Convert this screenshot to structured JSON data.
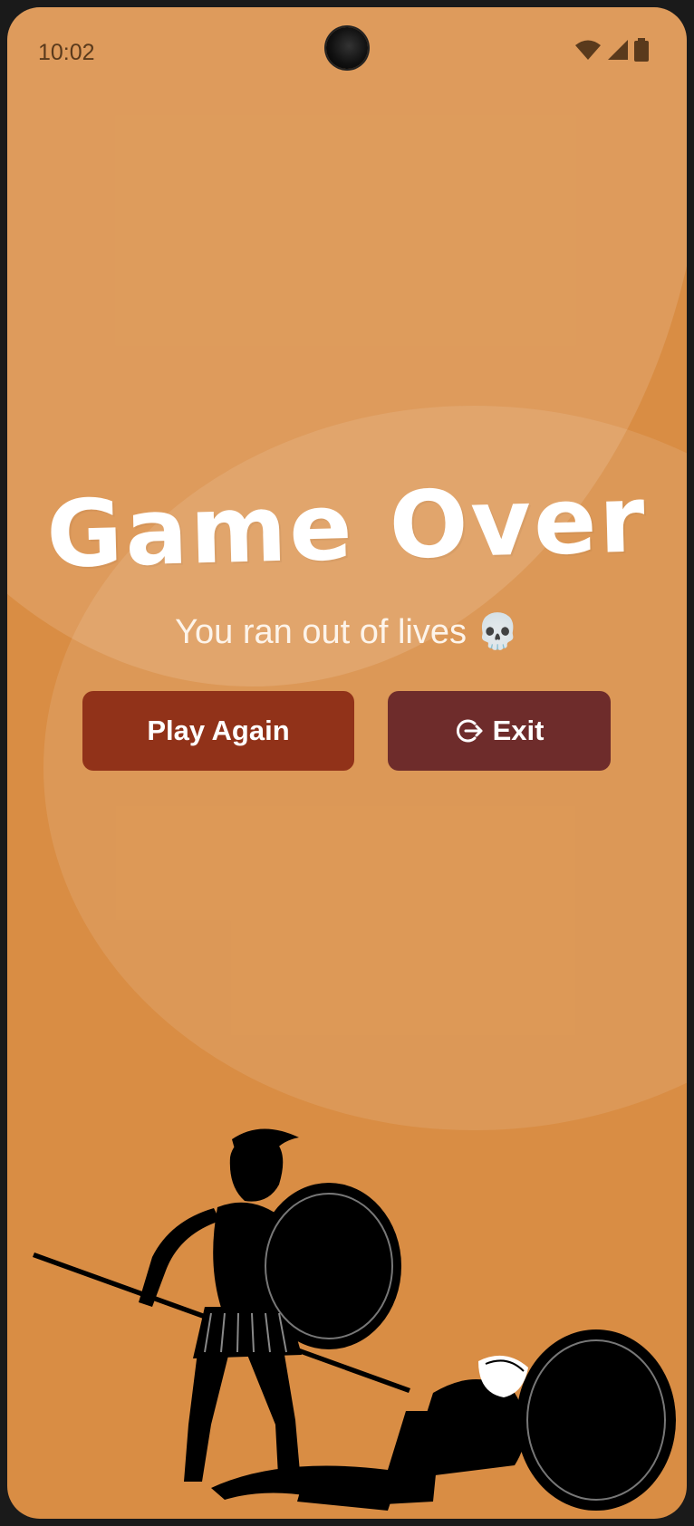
{
  "status_bar": {
    "time": "10:02",
    "icons": [
      "wifi-icon",
      "cellular-signal-icon",
      "battery-icon"
    ]
  },
  "game_over": {
    "title": "Game Over",
    "subtitle": "You ran out of lives 💀"
  },
  "buttons": {
    "play_again_label": "Play Again",
    "exit_label": "Exit",
    "exit_icon": "logout-icon"
  },
  "illustration": {
    "icon": "spartan-warriors-illustration"
  },
  "colors": {
    "background": "#d98d44",
    "play_again": "#913219",
    "exit": "#6e2c2b",
    "text": "#ffffff"
  }
}
